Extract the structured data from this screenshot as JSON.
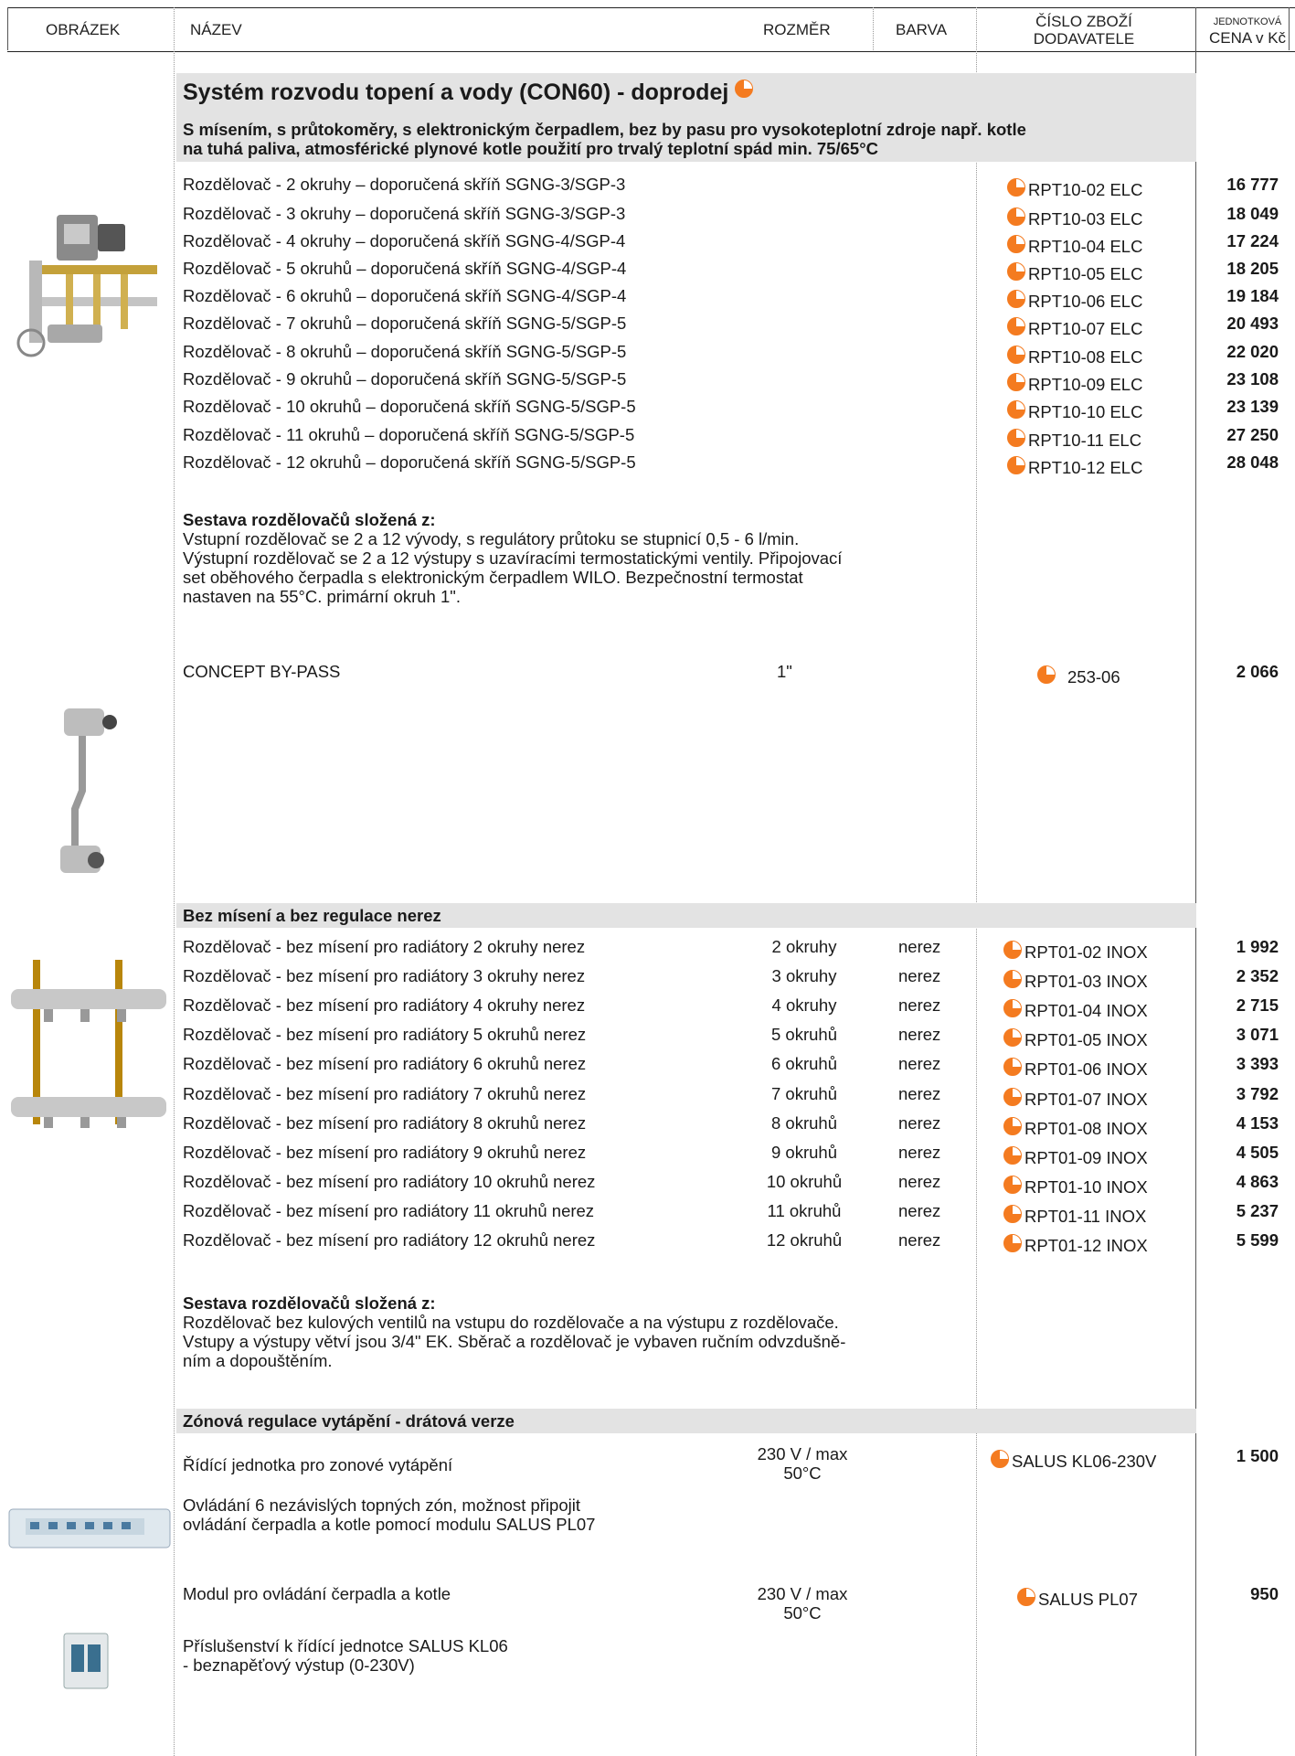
{
  "header": {
    "obrazek": "OBRÁZEK",
    "nazev": "NÁZEV",
    "rozmer": "ROZMĚR",
    "barva": "BARVA",
    "cislo_line1": "ČÍSLO ZBOŽÍ",
    "cislo_line2": "DODAVATELE",
    "cena_line1": "JEDNOTKOVÁ",
    "cena_line2": "CENA v Kč"
  },
  "section1": {
    "title": "Systém rozvodu topení a vody (CON60) - doprodej",
    "subtitle_line1": "S mísením, s průtokoměry, s elektronickým čerpadlem, bez by pasu pro vysokoteplotní zdroje např. kotle",
    "subtitle_line2": "na tuhá paliva, atmosférické plynové kotle použití pro trvalý teplotní spád min. 75/65°C",
    "items": [
      {
        "name": "Rozdělovač - 2 okruhy – doporučená skříň SGNG-3/SGP-3",
        "code": "RPT10-02 ELC",
        "price": "16 777"
      },
      {
        "name": "Rozdělovač - 3 okruhy – doporučená  skříň SGNG-3/SGP-3",
        "code": "RPT10-03 ELC",
        "price": "18 049"
      },
      {
        "name": "Rozdělovač - 4 okruhy – doporučená  skříň SGNG-4/SGP-4",
        "code": "RPT10-04 ELC",
        "price": "17 224"
      },
      {
        "name": "Rozdělovač - 5 okruhů – doporučená  skříň SGNG-4/SGP-4",
        "code": "RPT10-05 ELC",
        "price": "18 205"
      },
      {
        "name": "Rozdělovač - 6 okruhů – doporučená  skříň SGNG-4/SGP-4",
        "code": "RPT10-06 ELC",
        "price": "19 184"
      },
      {
        "name": "Rozdělovač - 7 okruhů – doporučená  skříň SGNG-5/SGP-5",
        "code": "RPT10-07 ELC",
        "price": "20 493"
      },
      {
        "name": "Rozdělovač - 8 okruhů – doporučená  skříň SGNG-5/SGP-5",
        "code": "RPT10-08 ELC",
        "price": "22 020"
      },
      {
        "name": "Rozdělovač - 9 okruhů – doporučená  skříň SGNG-5/SGP-5",
        "code": "RPT10-09 ELC",
        "price": "23 108"
      },
      {
        "name": "Rozdělovač - 10 okruhů – doporučená  skříň SGNG-5/SGP-5",
        "code": "RPT10-10 ELC",
        "price": "23 139"
      },
      {
        "name": "Rozdělovač - 11 okruhů – doporučená  skříň SGNG-5/SGP-5",
        "code": "RPT10-11 ELC",
        "price": "27 250"
      },
      {
        "name": "Rozdělovač - 12 okruhů – doporučená  skříň SGNG-5/SGP-5",
        "code": "RPT10-12 ELC",
        "price": "28 048"
      }
    ],
    "desc_title": "Sestava rozdělovačů složená z:",
    "desc_lines": [
      "Vstupní rozdělovač se 2 a 12 vývody, s regulátory průtoku se stupnicí 0,5 - 6 l/min.",
      "Výstupní rozdělovač se 2 a 12 výstupy s uzavíracími termostatickými ventily. Připojovací",
      "set oběhového čerpadla s elektronickým čerpadlem WILO. Bezpečnostní termostat",
      "nastaven na 55°C. primární okruh 1\"."
    ],
    "bypass": {
      "name": "CONCEPT BY-PASS",
      "size": "1\"",
      "code": "253-06",
      "price": "2 066"
    }
  },
  "section2": {
    "title": "Bez mísení a bez regulace nerez",
    "items": [
      {
        "name": "Rozdělovač - bez mísení pro radiátory 2 okruhy nerez",
        "size": "2 okruhy",
        "color": "nerez",
        "code": "RPT01-02 INOX",
        "price": "1 992"
      },
      {
        "name": "Rozdělovač - bez mísení pro radiátory 3 okruhy nerez",
        "size": "3 okruhy",
        "color": "nerez",
        "code": "RPT01-03 INOX",
        "price": "2 352"
      },
      {
        "name": "Rozdělovač - bez mísení pro radiátory 4 okruhy nerez",
        "size": "4 okruhy",
        "color": "nerez",
        "code": "RPT01-04 INOX",
        "price": "2 715"
      },
      {
        "name": "Rozdělovač - bez mísení pro radiátory 5 okruhů nerez",
        "size": "5 okruhů",
        "color": "nerez",
        "code": "RPT01-05 INOX",
        "price": "3 071"
      },
      {
        "name": "Rozdělovač - bez mísení pro radiátory 6 okruhů nerez",
        "size": "6 okruhů",
        "color": "nerez",
        "code": "RPT01-06 INOX",
        "price": "3 393"
      },
      {
        "name": "Rozdělovač - bez mísení pro radiátory 7 okruhů nerez",
        "size": "7 okruhů",
        "color": "nerez",
        "code": "RPT01-07 INOX",
        "price": "3 792"
      },
      {
        "name": "Rozdělovač - bez mísení pro radiátory 8 okruhů nerez",
        "size": "8 okruhů",
        "color": "nerez",
        "code": "RPT01-08 INOX",
        "price": "4 153"
      },
      {
        "name": "Rozdělovač - bez mísení pro radiátory 9 okruhů nerez",
        "size": "9 okruhů",
        "color": "nerez",
        "code": "RPT01-09 INOX",
        "price": "4 505"
      },
      {
        "name": "Rozdělovač - bez mísení pro radiátory 10 okruhů nerez",
        "size": "10 okruhů",
        "color": "nerez",
        "code": "RPT01-10 INOX",
        "price": "4 863"
      },
      {
        "name": "Rozdělovač - bez mísení pro radiátory 11 okruhů nerez",
        "size": "11 okruhů",
        "color": "nerez",
        "code": "RPT01-11 INOX",
        "price": "5 237"
      },
      {
        "name": "Rozdělovač - bez mísení pro radiátory 12 okruhů nerez",
        "size": "12 okruhů",
        "color": "nerez",
        "code": "RPT01-12 INOX",
        "price": "5 599"
      }
    ],
    "desc_title": "Sestava rozdělovačů složená z:",
    "desc_lines": [
      "Rozdělovač bez kulových ventilů na vstupu do rozdělovače a na výstupu z rozdělovače.",
      "Vstupy a výstupy větví jsou 3/4\" EK. Sběrač a rozdělovač je vybaven ručním odvzdušně-",
      "ním a dopouštěním."
    ]
  },
  "section3": {
    "title": "Zónová regulace vytápění - drátová verze",
    "item1": {
      "name": "Řídící jednotka pro zonové vytápění",
      "size_line1": "230 V / max",
      "size_line2": "50°C",
      "code": "SALUS KL06-230V",
      "price": "1 500",
      "desc_line1": "Ovládání 6 nezávislých topných zón, možnost připojit",
      "desc_line2": "ovládání čerpadla a kotle pomocí modulu SALUS PL07"
    },
    "item2": {
      "name": "Modul pro ovládání čerpadla a kotle",
      "size_line1": "230 V / max",
      "size_line2": "50°C",
      "code": "SALUS PL07",
      "price": "950",
      "desc_line1": "Příslušenství k řídící jednotce SALUS KL06",
      "desc_line2": "- beznapěťový výstup (0-230V)"
    }
  },
  "colors": {
    "accent": "#f47b20",
    "section_bg": "#e3e3e3"
  }
}
